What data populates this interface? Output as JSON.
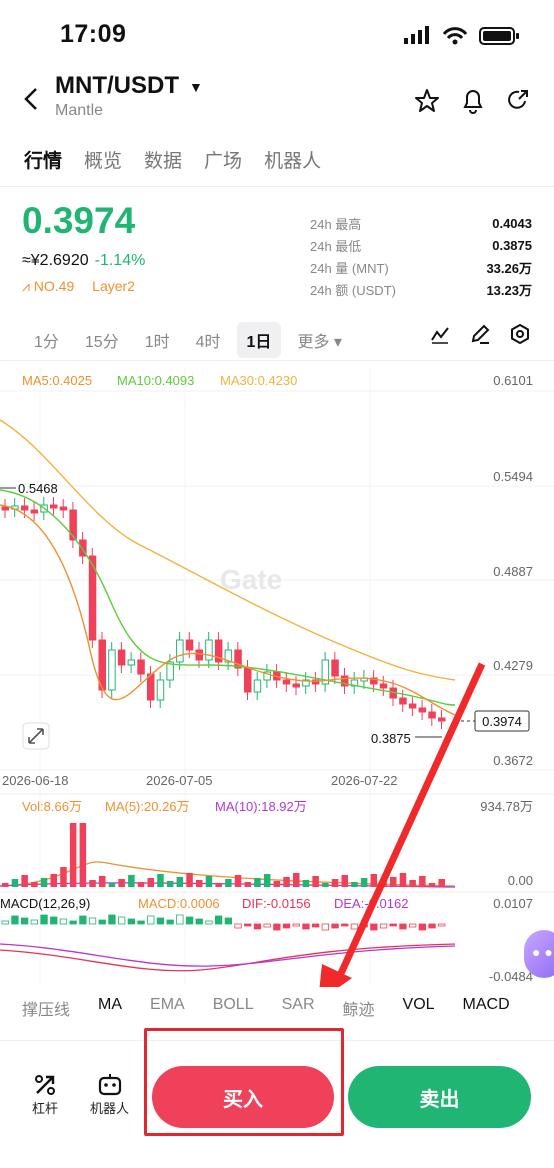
{
  "status": {
    "time": "17:09"
  },
  "header": {
    "pair": "MNT/USDT",
    "name": "Mantle"
  },
  "tabs": [
    "行情",
    "概览",
    "数据",
    "广场",
    "机器人"
  ],
  "price": {
    "last": "0.3974",
    "approx": "≈¥2.6920",
    "change": "-1.14%",
    "rank": "NO.49",
    "tag": "Layer2"
  },
  "stats": [
    {
      "k": "24h  最高",
      "v": "0.4043"
    },
    {
      "k": "24h  最低",
      "v": "0.3875"
    },
    {
      "k": "24h  量 (MNT)",
      "v": "33.26万"
    },
    {
      "k": "24h  额 (USDT)",
      "v": "13.23万"
    }
  ],
  "timeframes": [
    "1分",
    "15分",
    "1时",
    "4时",
    "1日",
    "更多 ▾"
  ],
  "ma_legend": {
    "ma5": "MA5:0.4025",
    "ma10": "MA10:0.4093",
    "ma30": "MA30:0.4230"
  },
  "y_axis": [
    "0.6101",
    "0.5494",
    "0.4887",
    "0.4279",
    "0.3672"
  ],
  "current_price_tag": "0.3974",
  "high_mark": "0.5468",
  "low_mark": "0.3875",
  "dates": [
    "2026-06-18",
    "2026-07-05",
    "2026-07-22"
  ],
  "vol_legend": {
    "vol": "Vol:8.66万",
    "ma5": "MA(5):20.26万",
    "ma10": "MA(10):18.92万"
  },
  "vol_axis": [
    "934.78万",
    "0.00"
  ],
  "macd_legend": {
    "macd": "MACD(12,26,9)",
    "val": "MACD:0.0006",
    "dif": "DIF:-0.0156",
    "dea": "DEA:-0.0162"
  },
  "macd_axis": [
    "0.0107",
    "-0.0484"
  ],
  "watermark": "Gate",
  "indicators": [
    "撑压线",
    "MA",
    "EMA",
    "BOLL",
    "SAR",
    "鲸迹",
    "VOL",
    "MACD"
  ],
  "bottom": {
    "leverage": "杠杆",
    "bot": "机器人",
    "buy": "买入",
    "sell": "卖出"
  },
  "colors": {
    "up": "#21b573",
    "down": "#f0415a",
    "ma5": "#f0902f",
    "ma10": "#5ccc3c",
    "ma30": "#f2b33d"
  }
}
